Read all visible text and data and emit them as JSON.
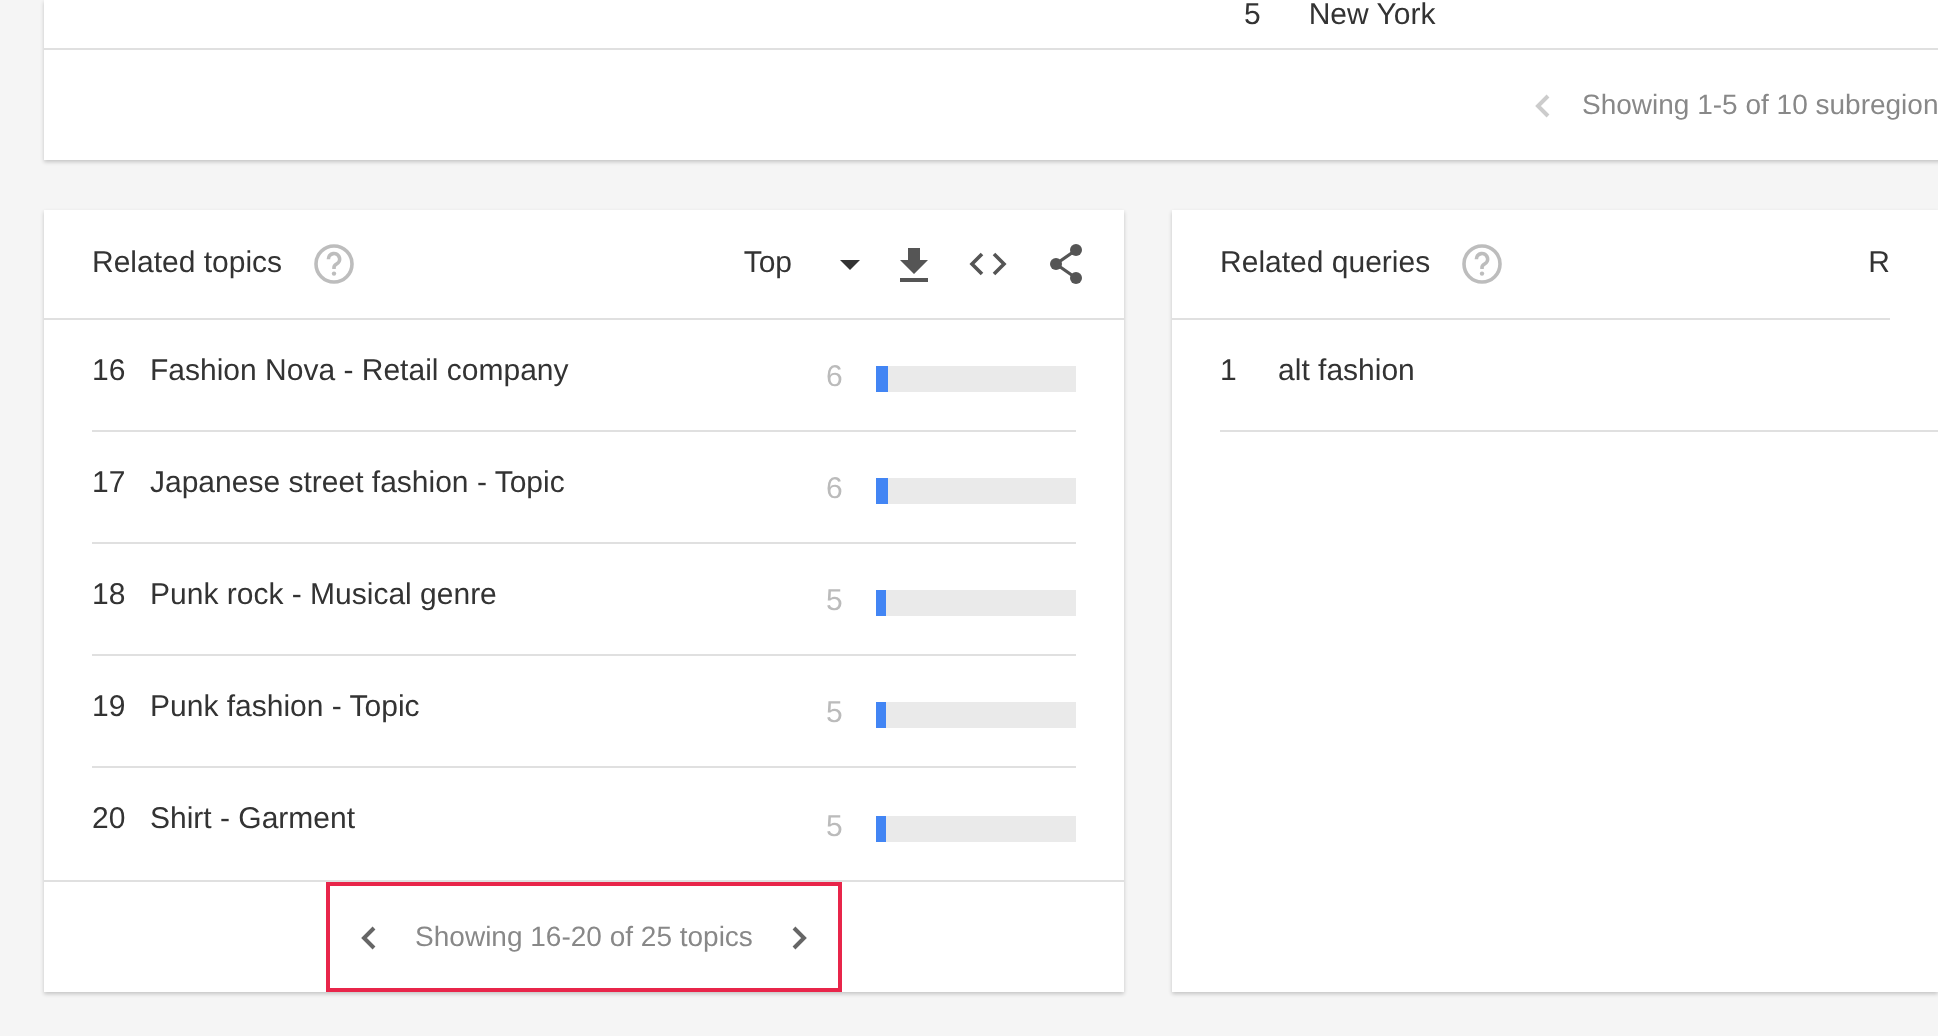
{
  "subregion_card": {
    "row": {
      "rank": "5",
      "name": "New York"
    },
    "pagination": {
      "text": "Showing 1-5 of 10 subregion",
      "prev_disabled": true
    }
  },
  "related_topics": {
    "title": "Related topics",
    "sort": "Top",
    "rows": [
      {
        "rank": "16",
        "name": "Fashion Nova - Retail company",
        "value": "6",
        "level": 0.06
      },
      {
        "rank": "17",
        "name": "Japanese street fashion - Topic",
        "value": "6",
        "level": 0.06
      },
      {
        "rank": "18",
        "name": "Punk rock - Musical genre",
        "value": "5",
        "level": 0.05
      },
      {
        "rank": "19",
        "name": "Punk fashion - Topic",
        "value": "5",
        "level": 0.05
      },
      {
        "rank": "20",
        "name": "Shirt - Garment",
        "value": "5",
        "level": 0.05
      }
    ],
    "pagination": {
      "text": "Showing 16-20 of 25 topics",
      "prev_disabled": false,
      "highlighted": true
    }
  },
  "related_queries": {
    "title": "Related queries",
    "sort": "R",
    "rows": [
      {
        "rank": "1",
        "name": "alt fashion"
      }
    ]
  }
}
